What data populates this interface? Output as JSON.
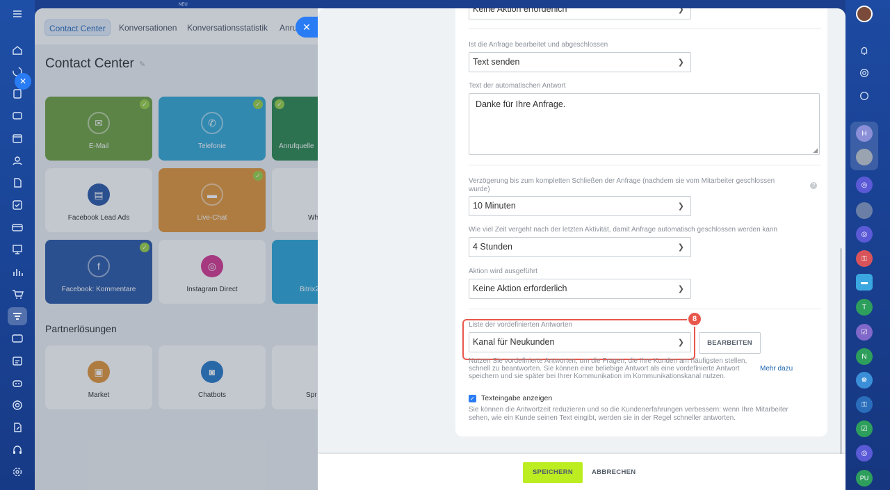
{
  "left_rail": {
    "badge": "NEU",
    "icons": [
      "menu-icon",
      "home-icon",
      "close-icon",
      "document-icon",
      "chat-icon",
      "calendar-icon",
      "contacts-icon",
      "file-icon",
      "task-icon",
      "card-icon",
      "board-icon",
      "chart-icon",
      "cart-icon",
      "filter-icon",
      "id-icon",
      "timeline-icon",
      "robot-icon",
      "target-icon",
      "edit-icon",
      "headset-icon",
      "settings-icon"
    ]
  },
  "background_page": {
    "tabs": [
      "Contact Center",
      "Konversationen",
      "Konversationsstatistik",
      "Anru"
    ],
    "title": "Contact Center",
    "tiles": [
      {
        "label": "E-Mail",
        "color": "#72a345",
        "checked": true
      },
      {
        "label": "Telefonie",
        "color": "#35a9d6",
        "checked": true
      },
      {
        "label": "Anrufquelle",
        "color": "#2f8a53",
        "checked": true
      },
      {
        "label": "Facebook Lead Ads",
        "color": "#ffffff",
        "checked": false
      },
      {
        "label": "Live-Chat",
        "color": "#e2983c",
        "checked": true
      },
      {
        "label": "Wh",
        "color": "#ffffff",
        "checked": false
      },
      {
        "label": "Facebook: Kommentare",
        "color": "#2d5aa8",
        "checked": true
      },
      {
        "label": "Instagram Direct",
        "color": "#ffffff",
        "checked": false
      },
      {
        "label": "Bitrix2",
        "color": "#2fa8d9",
        "checked": false
      },
      {
        "label": "Market",
        "color": "#ffffff",
        "checked": false
      },
      {
        "label": "Chatbots",
        "color": "#ffffff",
        "checked": false
      },
      {
        "label": "Spr",
        "color": "#ffffff",
        "checked": false
      }
    ],
    "partners_heading": "Partnerlösungen"
  },
  "form": {
    "top_select_value": "Keine Aktion erforderlich",
    "processed_label": "Ist die Anfrage bearbeitet und abgeschlossen",
    "processed_value": "Text senden",
    "autoreply_label": "Text der automatischen Antwort",
    "autoreply_text": "Danke für Ihre Anfrage.",
    "delay_label": "Verzögerung bis zum kompletten Schließen der Anfrage (nachdem sie vom Mitarbeiter geschlossen wurde)",
    "delay_value": "10 Minuten",
    "inactivity_label": "Wie viel Zeit vergeht nach der letzten Aktivität, damit Anfrage automatisch geschlossen werden kann",
    "inactivity_value": "4 Stunden",
    "action_label": "Aktion wird ausgeführt",
    "action_value": "Keine Aktion erforderlich",
    "predefined_label": "Liste der vordefinierten Antworten",
    "predefined_value": "Kanal für Neukunden",
    "edit_button": "BEARBEITEN",
    "step_badge": "8",
    "predefined_help": "Nutzen Sie vordefinierte Antworten, um die Fragen, die Ihre Kunden am häufigsten stellen, schnell zu beantworten. Sie können eine beliebige Antwort als eine vordefinierte Antwort speichern und sie später bei Ihrer Kommunikation im Kommunikationskanal nutzen.",
    "more_link": "Mehr dazu",
    "typing_checkbox_label": "Texteingabe anzeigen",
    "typing_checked": true,
    "typing_help": "Sie können die Antwortzeit reduzieren und so die Kundenerfahrungen verbessern: wenn Ihre Mitarbeiter sehen, wie ein Kunde seinen Text eingibt, werden sie in der Regel schneller antworten."
  },
  "footer": {
    "save": "SPEICHERN",
    "cancel": "ABBRECHEN"
  },
  "right_rail": {
    "items": [
      "avatar",
      "bell-icon",
      "target-icon",
      "chat-bubble-icon",
      "H",
      "avatar",
      "open-channel-icon",
      "avatar",
      "open-channel-icon",
      "lock-icon",
      "chat-icon",
      "T",
      "task-icon",
      "N",
      "group-icon",
      "lock-icon",
      "task-icon",
      "open-channel-icon",
      "PU"
    ]
  },
  "colors": {
    "accent_blue": "#2a7cf5",
    "save_green": "#bbed21",
    "highlight_red": "#e8574b",
    "link_blue": "#2067b0"
  }
}
